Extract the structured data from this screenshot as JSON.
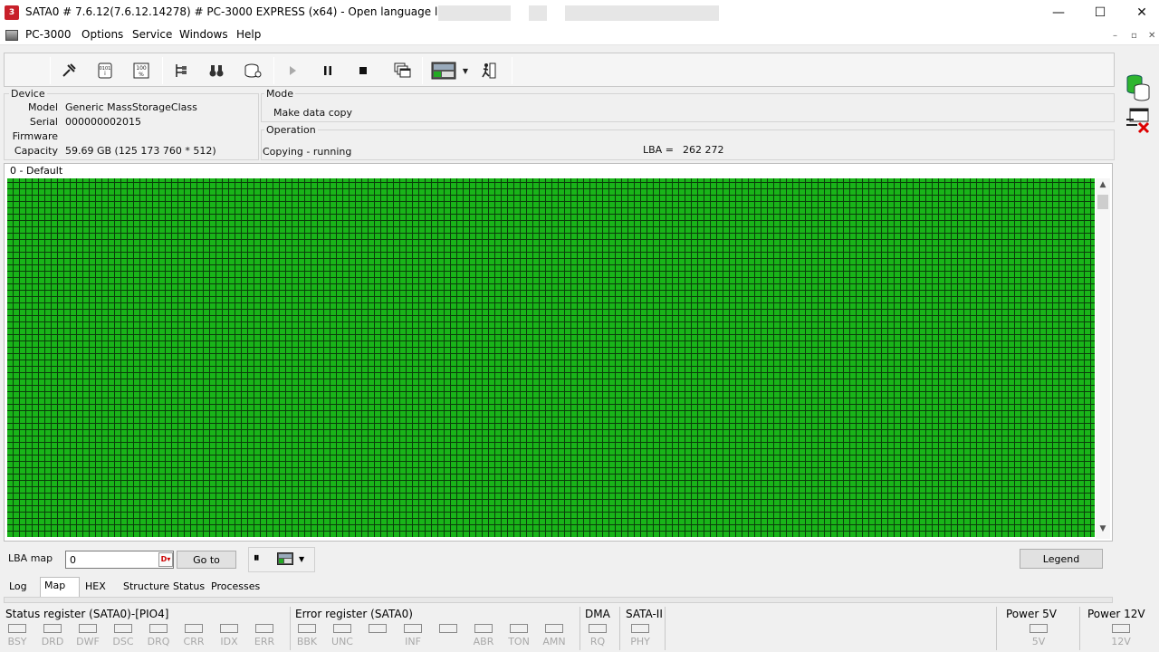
{
  "window": {
    "title": "SATA0 # 7.6.12(7.6.12.14278) # PC-3000 EXPRESS (x64) - Open language license -",
    "minimize": "—",
    "maximize": "☐",
    "close": "✕"
  },
  "menu": {
    "items": [
      "PC-3000",
      "Options",
      "Service",
      "Windows",
      "Help"
    ],
    "mdi_min": "–",
    "mdi_restore": "▫",
    "mdi_close": "✕"
  },
  "toolbar": {
    "icons": [
      "tools-icon",
      "sector-icon",
      "percent-icon",
      "tree-icon",
      "binoculars-icon",
      "disk-icon",
      "play-icon",
      "pause-icon",
      "stop-icon",
      "copy-windows-icon",
      "monitor-dropdown-icon",
      "run-exit-icon"
    ]
  },
  "device": {
    "group_title": "Device",
    "model_label": "Model",
    "model_value": "Generic MassStorageClass",
    "serial_label": "Serial",
    "serial_value": "000000002015",
    "firmware_label": "Firmware",
    "firmware_value": "",
    "capacity_label": "Capacity",
    "capacity_value": "59.69 GB (125 173 760 * 512)"
  },
  "mode": {
    "group_title": "Mode",
    "value": "Make data copy"
  },
  "operation": {
    "group_title": "Operation",
    "status": "Copying - running",
    "lba_label": "LBA =",
    "lba_value": "262 272"
  },
  "map": {
    "title": "0 - Default",
    "cell_color": "#19b419",
    "cell_border": "#0b3d0b"
  },
  "lba_bar": {
    "label": "LBA map",
    "input_value": "0",
    "goto_label": "Go to",
    "pause_symbol": "⏸",
    "legend_label": "Legend"
  },
  "tabs": [
    "Log",
    "Map",
    "HEX",
    "Structure",
    "Status",
    "Processes"
  ],
  "active_tab": "Map",
  "status_register": {
    "title": "Status register (SATA0)-[PIO4]",
    "flags": [
      "BSY",
      "DRD",
      "DWF",
      "DSC",
      "DRQ",
      "CRR",
      "IDX",
      "ERR"
    ]
  },
  "error_register": {
    "title": "Error register (SATA0)",
    "flags": [
      "BBK",
      "UNC",
      "",
      "INF",
      "",
      "ABR",
      "TON",
      "AMN"
    ]
  },
  "dma": {
    "title": "DMA",
    "flag": "RQ"
  },
  "sata2": {
    "title": "SATA-II",
    "flag": "PHY"
  },
  "power5": {
    "title": "Power 5V",
    "flag": "5V"
  },
  "power12": {
    "title": "Power 12V",
    "flag": "12V"
  }
}
